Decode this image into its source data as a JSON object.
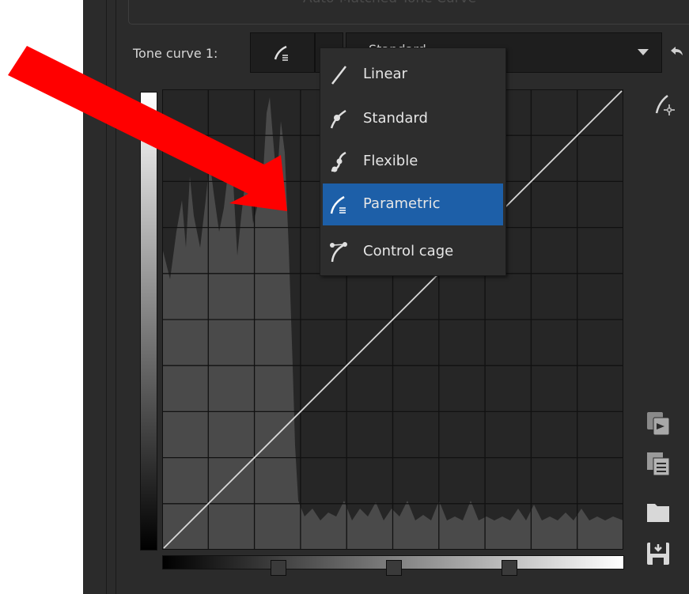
{
  "panel": {
    "header_title": "Auto-Matched Tone Curve",
    "tone_curve_label": "Tone curve 1:",
    "preset_value": "Standard"
  },
  "menu": {
    "items": [
      {
        "label": "Linear",
        "icon": "linear-curve-icon"
      },
      {
        "label": "Standard",
        "icon": "standard-curve-icon"
      },
      {
        "label": "Flexible",
        "icon": "flexible-curve-icon"
      },
      {
        "label": "Parametric",
        "icon": "parametric-curve-icon",
        "selected": true
      },
      {
        "label": "Control cage",
        "icon": "control-cage-icon"
      }
    ]
  },
  "side_tools": [
    "curve-picker-icon",
    "apply-icon",
    "copy-icon",
    "open-folder-icon",
    "save-icon"
  ],
  "colors": {
    "selection": "#1d5fa8",
    "annotation_arrow": "#ff0000",
    "panel_bg": "#2b2b2b"
  }
}
